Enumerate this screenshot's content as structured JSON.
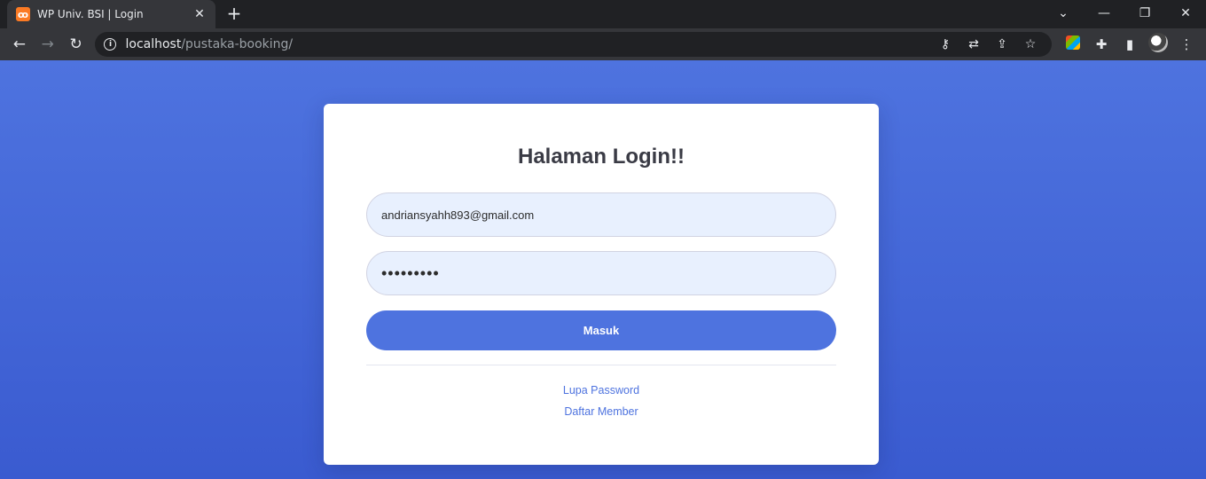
{
  "browser": {
    "tab_title": "WP Univ. BSI | Login",
    "tab_favicon": "xampp-icon",
    "url_host": "localhost",
    "url_path": "/pustaka-booking/",
    "window_controls": [
      "minimize-icon",
      "restore-icon",
      "close-icon"
    ]
  },
  "login": {
    "title": "Halaman Login!!",
    "email_value": "andriansyahh893@gmail.com",
    "password_value": "•••••••••",
    "submit_label": "Masuk",
    "forgot_link": "Lupa Password",
    "register_link": "Daftar Member"
  },
  "colors": {
    "background": "#4e73df",
    "button": "#4e73df",
    "input_bg": "#e8f0fe",
    "link": "#4e73df"
  }
}
